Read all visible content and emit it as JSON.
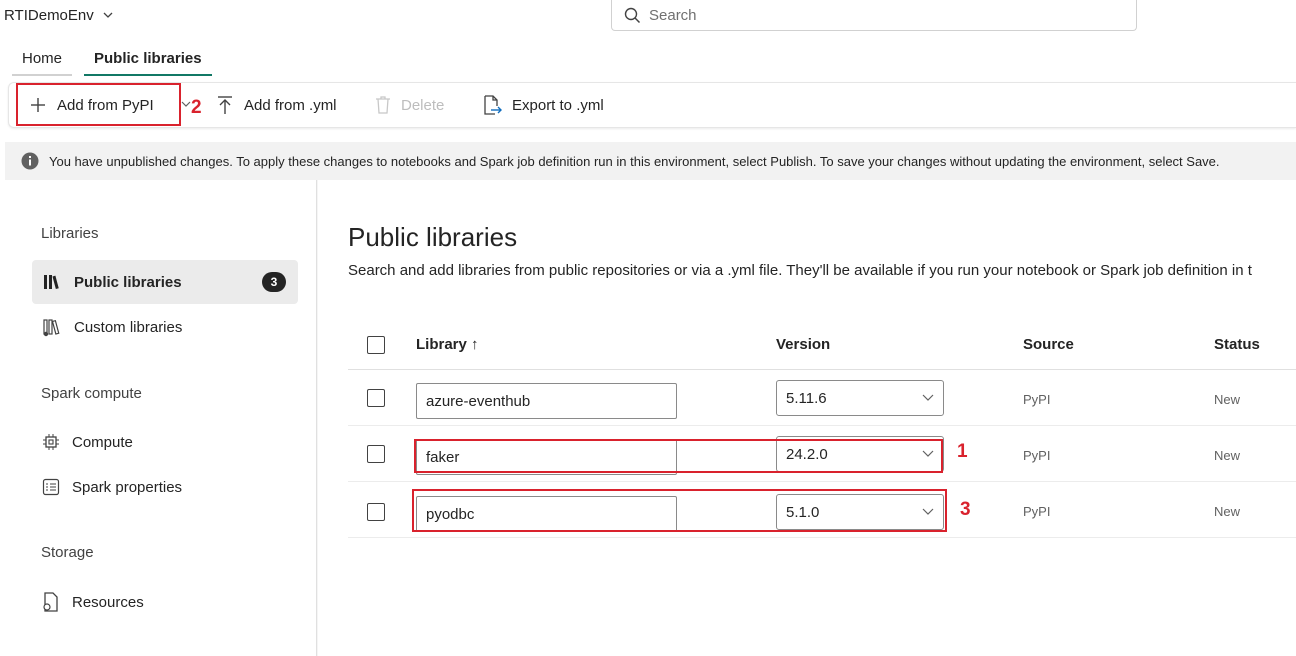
{
  "workspace": {
    "name": "RTIDemoEnv"
  },
  "search": {
    "placeholder": "Search"
  },
  "tabs": [
    {
      "label": "Home"
    },
    {
      "label": "Public libraries"
    }
  ],
  "toolbar": {
    "add_pypi": "Add from PyPI",
    "add_yml": "Add from .yml",
    "delete": "Delete",
    "export_yml": "Export to .yml"
  },
  "banner": {
    "text": "You have unpublished changes. To apply these changes to notebooks and Spark job definition run in this environment, select Publish. To save your changes without updating the environment, select Save."
  },
  "sidebar": {
    "libraries_heading": "Libraries",
    "public_libraries": "Public libraries",
    "public_libraries_count": "3",
    "custom_libraries": "Custom libraries",
    "spark_heading": "Spark compute",
    "compute": "Compute",
    "spark_properties": "Spark properties",
    "storage_heading": "Storage",
    "resources": "Resources"
  },
  "main": {
    "title": "Public libraries",
    "description": "Search and add libraries from public repositories or via a .yml file. They'll be available if you run your notebook or Spark job definition in t",
    "columns": {
      "library": "Library ↑",
      "version": "Version",
      "source": "Source",
      "status": "Status"
    },
    "rows": [
      {
        "library": "azure-eventhub",
        "version": "5.11.6",
        "source": "PyPI",
        "status": "New"
      },
      {
        "library": "faker",
        "version": "24.2.0",
        "source": "PyPI",
        "status": "New"
      },
      {
        "library": "pyodbc",
        "version": "5.1.0",
        "source": "PyPI",
        "status": "New"
      }
    ]
  },
  "annotations": {
    "one": "1",
    "two": "2",
    "three": "3"
  },
  "colors": {
    "accent": "#117865",
    "highlight": "#d9222d"
  }
}
